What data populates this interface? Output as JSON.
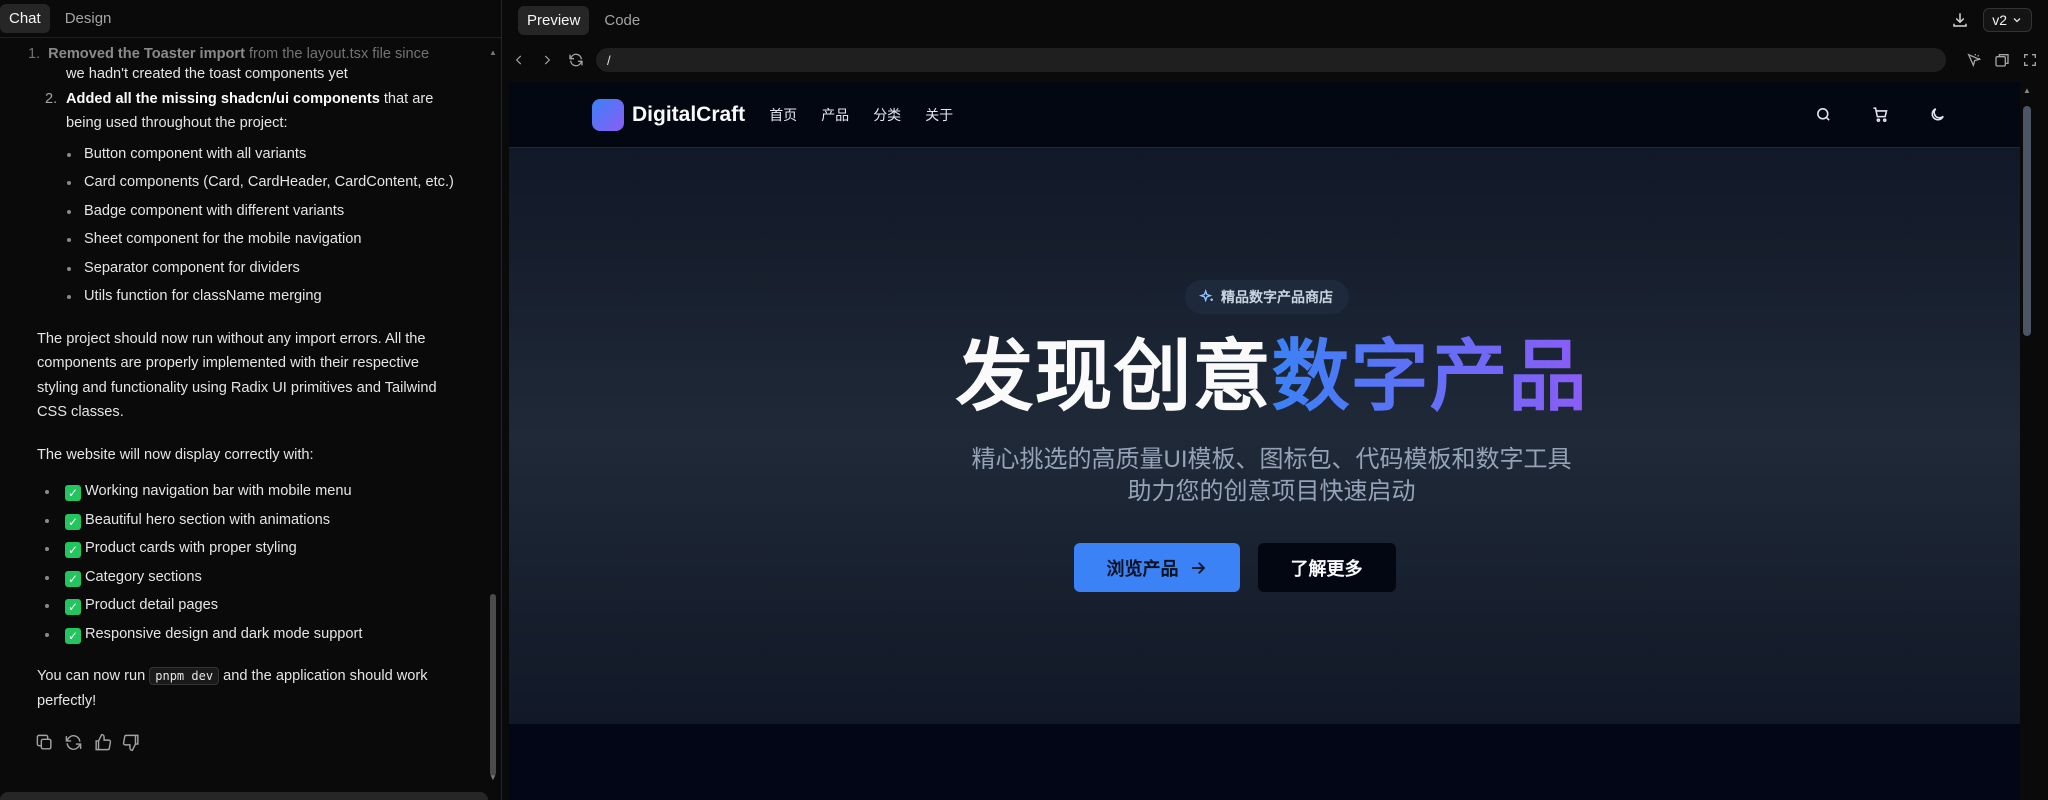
{
  "left_tabs": {
    "chat": "Chat",
    "design": "Design"
  },
  "chat": {
    "faded_line_bold": "Removed the Toaster import",
    "faded_line_rest": " from the layout.tsx file since",
    "item1_cont": "we hadn't created the toast components yet",
    "item2_num": "2.",
    "item1_num": "1.",
    "item2_bold": "Added all the missing shadcn/ui components",
    "item2_rest": " that are being used throughout the project:",
    "components": [
      "Button component with all variants",
      "Card components (Card, CardHeader, CardContent, etc.)",
      "Badge component with different variants",
      "Sheet component for the mobile navigation",
      "Separator component for dividers",
      "Utils function for className merging"
    ],
    "para1": "The project should now run without any import errors. All the components are properly implemented with their respective styling and functionality using Radix UI primitives and Tailwind CSS classes.",
    "para2": "The website will now display correctly with:",
    "check_mark": "✓",
    "checks": [
      "Working navigation bar with mobile menu",
      "Beautiful hero section with animations",
      "Product cards with proper styling",
      "Category sections",
      "Product detail pages",
      "Responsive design and dark mode support"
    ],
    "final_before": "You can now run ",
    "final_code": "pnpm dev",
    "final_after": " and the application should work perfectly!"
  },
  "right_tabs": {
    "preview": "Preview",
    "code": "Code"
  },
  "version": "v2",
  "url": "/",
  "site": {
    "brand": "DigitalCraft",
    "menu": [
      "首页",
      "产品",
      "分类",
      "关于"
    ],
    "badge": "精品数字产品商店",
    "title_plain": "发现创意",
    "title_gradient": "数字产品",
    "subtitle_line1": "精心挑选的高质量UI模板、图标包、代码模板和数字工具",
    "subtitle_line2": "助力您的创意项目快速启动",
    "primary_button": "浏览产品",
    "secondary_button": "了解更多"
  },
  "colors": {
    "accent_blue": "#3b82f6",
    "accent_purple": "#8b5cf6",
    "check_green": "#22c55e"
  }
}
